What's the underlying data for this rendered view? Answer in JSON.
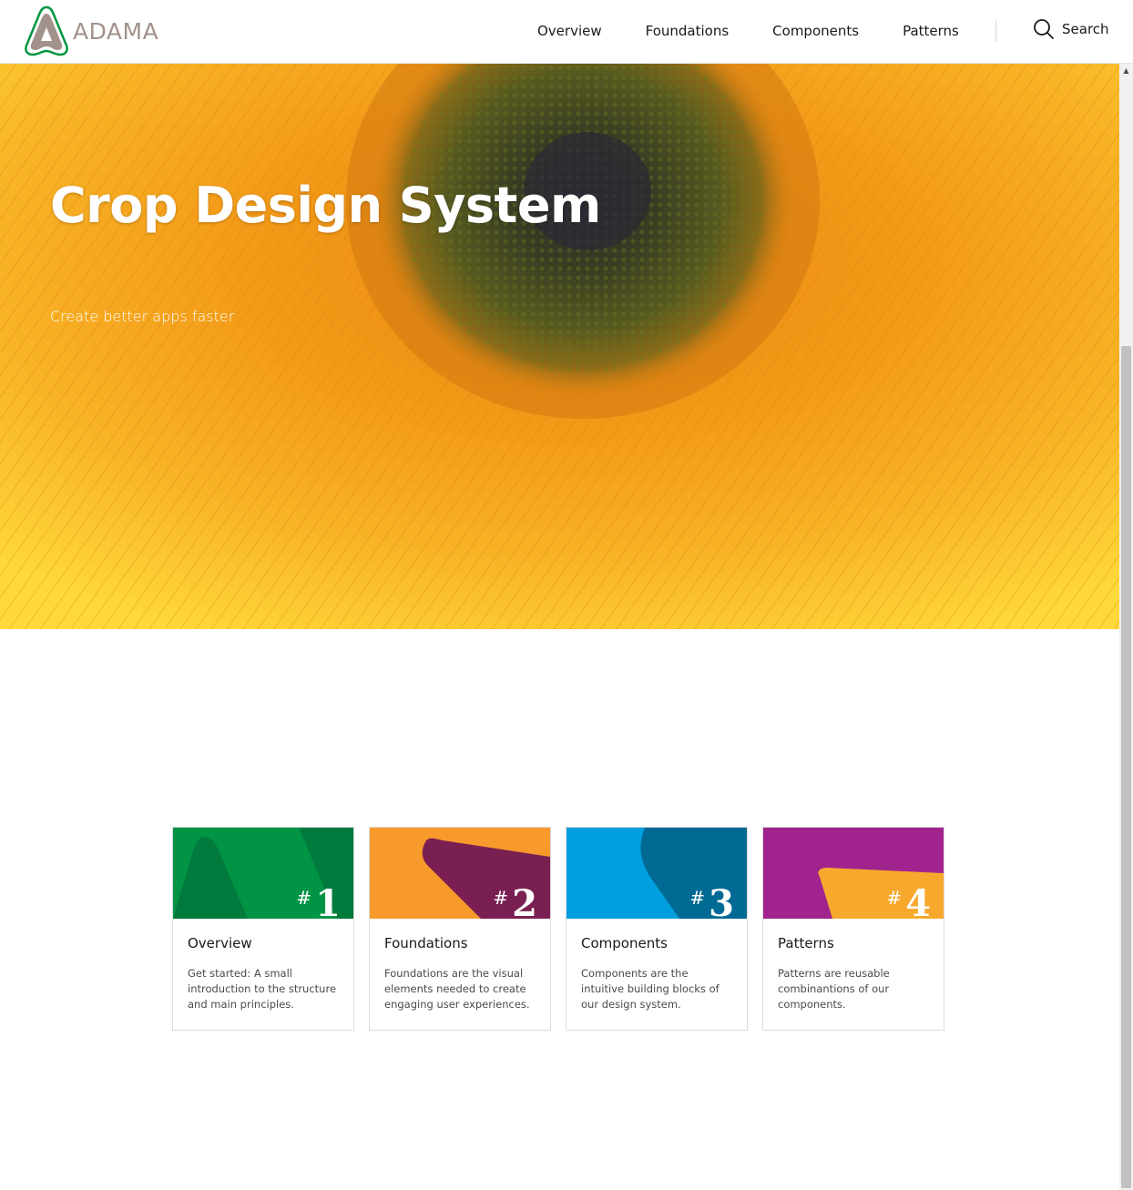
{
  "header": {
    "logo_text": "ADAMA",
    "nav": [
      "Overview",
      "Foundations",
      "Components",
      "Patterns"
    ],
    "search_label": "Search"
  },
  "hero": {
    "title": "Crop Design System",
    "subtitle": "Create better apps faster"
  },
  "cards": [
    {
      "number": "1",
      "hash": "#",
      "title": "Overview",
      "description": "Get started: A small introduction to the structure and main principles.",
      "color": "#009444",
      "accent": "#007a3d"
    },
    {
      "number": "2",
      "hash": "#",
      "title": "Foundations",
      "description": "Foundations are the visual elements needed to create engaging user experiences.",
      "color": "#f79a2b",
      "accent": "#7a1f52"
    },
    {
      "number": "3",
      "hash": "#",
      "title": "Components",
      "description": "Components are the intuitive building blocks of our design system.",
      "color": "#009fdf",
      "accent": "#006a94"
    },
    {
      "number": "4",
      "hash": "#",
      "title": "Patterns",
      "description": "Patterns are reusable combinantions of our components.",
      "color": "#a1238e",
      "accent": "#f7a92d"
    }
  ],
  "colors": {
    "logo_green": "#00963f",
    "logo_brown": "#a3918b",
    "hero_orange": "#f6a41c"
  }
}
